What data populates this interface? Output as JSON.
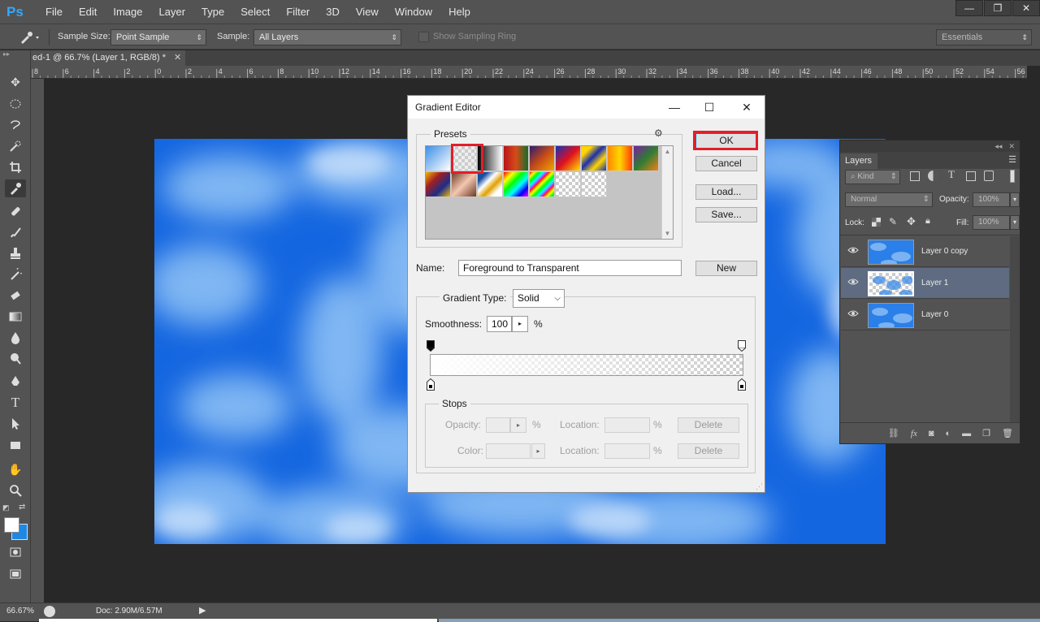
{
  "app": {
    "logo": "Ps"
  },
  "menu": [
    "File",
    "Edit",
    "Image",
    "Layer",
    "Type",
    "Select",
    "Filter",
    "3D",
    "View",
    "Window",
    "Help"
  ],
  "window_controls": {
    "minimize": "—",
    "restore": "❐",
    "close": "✕"
  },
  "options_bar": {
    "sample_size_label": "Sample Size:",
    "sample_size_value": "Point Sample",
    "sample_label": "Sample:",
    "sample_value": "All Layers",
    "show_ring_label": "Show Sampling Ring",
    "workspace": "Essentials"
  },
  "document_tab": {
    "title": "ed-1 @ 66.7% (Layer 1, RGB/8) *",
    "close": "✕"
  },
  "ruler_ticks": [
    "8",
    "6",
    "4",
    "2",
    "0",
    "2",
    "4",
    "6",
    "8",
    "10",
    "12",
    "14",
    "16",
    "18",
    "20",
    "22",
    "24",
    "26",
    "28",
    "30",
    "32",
    "34",
    "36",
    "38",
    "40",
    "42",
    "44",
    "46",
    "48",
    "50",
    "52",
    "54",
    "56"
  ],
  "status_bar": {
    "zoom": "66.67%",
    "doc_info": "Doc: 2.90M/6.57M"
  },
  "layers_panel": {
    "tab": "Layers",
    "kind_label": "Kind",
    "blend_mode": "Normal",
    "opacity_label": "Opacity:",
    "opacity_value": "100%",
    "lock_label": "Lock:",
    "fill_label": "Fill:",
    "fill_value": "100%",
    "layers": [
      {
        "name": "Layer 0 copy",
        "selected": false
      },
      {
        "name": "Layer 1",
        "selected": true
      },
      {
        "name": "Layer 0",
        "selected": false
      }
    ],
    "bottom_icons": [
      "link-icon",
      "fx-icon",
      "mask-icon",
      "adjustment-icon",
      "folder-icon",
      "new-layer-icon",
      "trash-icon"
    ]
  },
  "gradient_editor": {
    "title": "Gradient Editor",
    "presets_label": "Presets",
    "buttons": {
      "ok": "OK",
      "cancel": "Cancel",
      "load": "Load...",
      "save": "Save...",
      "new": "New"
    },
    "name_label": "Name:",
    "name_value": "Foreground to Transparent",
    "gradient_type_label": "Gradient Type:",
    "gradient_type_value": "Solid",
    "smoothness_label": "Smoothness:",
    "smoothness_value": "100",
    "percent": "%",
    "stops_label": "Stops",
    "opacity_label": "Opacity:",
    "color_label": "Color:",
    "location_label": "Location:",
    "delete_label": "Delete",
    "highlighted_preset": "Foreground to Transparent"
  },
  "colors": {
    "highlight_red": "#e31e2b",
    "sky_blue": "#1e6ee8",
    "ps_blue": "#31a8ff"
  }
}
